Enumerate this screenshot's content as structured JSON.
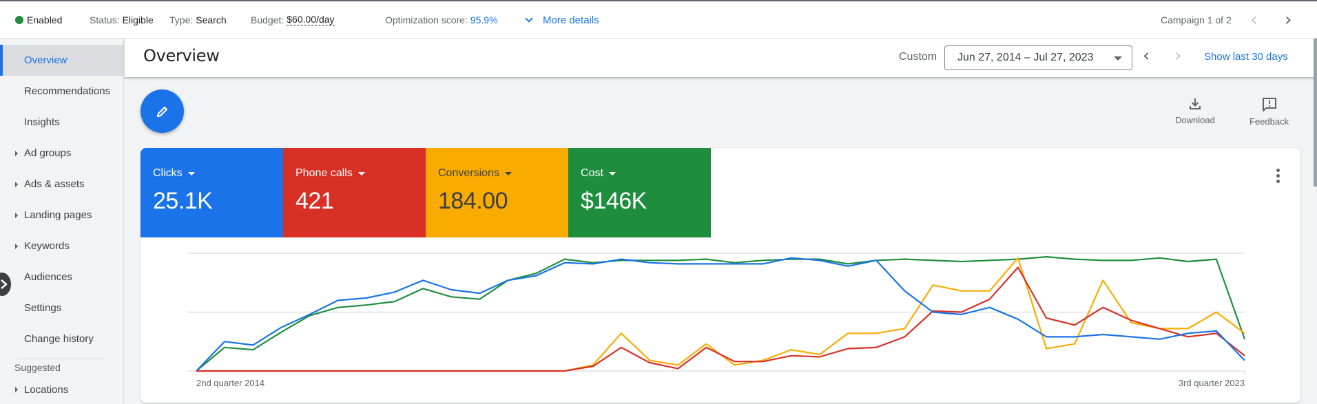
{
  "topbar": {
    "status_enabled": "Enabled",
    "status_label": "Status:",
    "status_value": "Eligible",
    "type_label": "Type:",
    "type_value": "Search",
    "budget_label": "Budget:",
    "budget_value": "$60.00/day",
    "opt_label": "Optimization score:",
    "opt_value": "95.9%",
    "more_details": "More details",
    "campaign_pager": "Campaign 1 of 2",
    "prev_icon": "‹",
    "next_icon": "›"
  },
  "sidebar": {
    "items": [
      {
        "label": "Overview",
        "active": true,
        "expandable": false
      },
      {
        "label": "Recommendations",
        "expandable": false
      },
      {
        "label": "Insights",
        "expandable": false
      },
      {
        "label": "Ad groups",
        "expandable": true
      },
      {
        "label": "Ads & assets",
        "expandable": true
      },
      {
        "label": "Landing pages",
        "expandable": true
      },
      {
        "label": "Keywords",
        "expandable": true
      },
      {
        "label": "Audiences",
        "expandable": false
      },
      {
        "label": "Settings",
        "expandable": false
      },
      {
        "label": "Change history",
        "expandable": false
      }
    ],
    "section_label": "Suggested",
    "suggested_items": [
      {
        "label": "Locations",
        "expandable": true
      }
    ]
  },
  "subheader": {
    "title": "Overview",
    "custom_label": "Custom",
    "date_range": "Jun 27, 2014 – Jul 27, 2023",
    "prev_icon": "‹",
    "next_icon": "›",
    "show_last": "Show last 30 days"
  },
  "toolbar": {
    "edit_icon": "pencil-icon",
    "download_label": "Download",
    "feedback_label": "Feedback"
  },
  "metrics": [
    {
      "label": "Clicks",
      "value": "25.1K",
      "color": "#1a73e8",
      "text_color": "#ffffff"
    },
    {
      "label": "Phone calls",
      "value": "421",
      "color": "#d93025",
      "text_color": "#ffffff"
    },
    {
      "label": "Conversions",
      "value": "184.00",
      "color": "#f9ab00",
      "text_color": "#3c4043"
    },
    {
      "label": "Cost",
      "value": "$146K",
      "color": "#1e8e3e",
      "text_color": "#ffffff"
    }
  ],
  "chart_data": {
    "type": "line",
    "title": "",
    "xlabel": "",
    "ylabel": "",
    "x_tick_labels": [
      "2nd quarter 2014",
      "3rd quarter 2023"
    ],
    "y_scale": "normalized per-series (no y-axis labels shown)",
    "ylim": [
      0,
      100
    ],
    "grid": true,
    "legend": "metric tiles (top)",
    "point_count": 38,
    "series": [
      {
        "name": "Clicks",
        "color": "#1a73e8",
        "values": [
          0,
          25,
          22,
          37,
          48,
          60,
          62,
          67,
          77,
          69,
          66,
          77,
          81,
          92,
          91,
          95,
          92,
          91,
          91,
          91,
          91,
          96,
          94,
          89,
          94,
          68,
          50,
          48,
          54,
          44,
          29,
          29,
          31,
          29,
          27,
          32,
          34,
          9
        ]
      },
      {
        "name": "Phone calls",
        "color": "#d93025",
        "values": [
          0,
          0,
          0,
          0,
          0,
          0,
          0,
          0,
          0,
          0,
          0,
          0,
          0,
          0,
          4,
          20,
          7,
          2,
          20,
          8,
          8,
          13,
          12,
          19,
          20,
          29,
          51,
          50,
          61,
          88,
          45,
          39,
          54,
          43,
          36,
          29,
          32,
          13
        ]
      },
      {
        "name": "Conversions",
        "color": "#f9ab00",
        "values": [
          0,
          0,
          0,
          0,
          0,
          0,
          0,
          0,
          0,
          0,
          0,
          0,
          0,
          0,
          5,
          32,
          9,
          5,
          23,
          5,
          9,
          18,
          14,
          32,
          32,
          36,
          73,
          68,
          68,
          96,
          19,
          23,
          77,
          41,
          36,
          36,
          50,
          32
        ]
      },
      {
        "name": "Cost",
        "color": "#1e8e3e",
        "values": [
          0,
          20,
          18,
          33,
          47,
          54,
          56,
          59,
          70,
          63,
          61,
          77,
          83,
          95,
          92,
          94,
          94,
          94,
          95,
          92,
          94,
          95,
          95,
          91,
          94,
          95,
          94,
          93,
          94,
          95,
          97,
          95,
          94,
          94,
          96,
          93,
          95,
          27
        ]
      }
    ]
  }
}
